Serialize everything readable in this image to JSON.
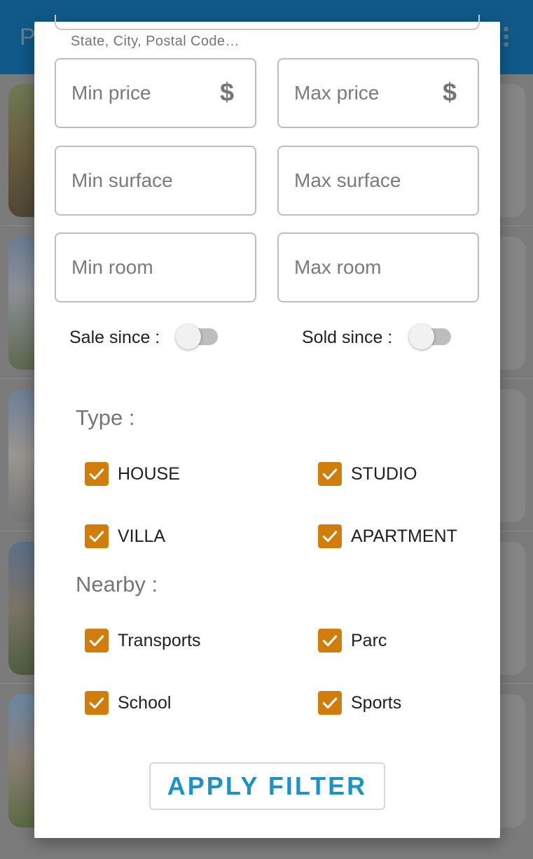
{
  "app_bar": {
    "title": "P"
  },
  "filter": {
    "address_helper": "State, City, Postal Code…",
    "price": {
      "min_placeholder": "Min price",
      "max_placeholder": "Max price",
      "currency_symbol": "$"
    },
    "surface": {
      "min_placeholder": "Min surface",
      "max_placeholder": "Max surface"
    },
    "room": {
      "min_placeholder": "Min room",
      "max_placeholder": "Max room"
    },
    "sale_since": {
      "label": "Sale since :",
      "enabled": false
    },
    "sold_since": {
      "label": "Sold since :",
      "enabled": false
    },
    "type": {
      "label": "Type :",
      "options": [
        {
          "label": "HOUSE",
          "checked": true
        },
        {
          "label": "STUDIO",
          "checked": true
        },
        {
          "label": "VILLA",
          "checked": true
        },
        {
          "label": "APARTMENT",
          "checked": true
        }
      ]
    },
    "nearby": {
      "label": "Nearby :",
      "options": [
        {
          "label": "Transports",
          "checked": true
        },
        {
          "label": "Parc",
          "checked": true
        },
        {
          "label": "School",
          "checked": true
        },
        {
          "label": "Sports",
          "checked": true
        }
      ]
    },
    "apply_label": "APPLY FILTER"
  },
  "colors": {
    "accent_checkbox": "#d07d0c",
    "apply_text": "#1d92c9",
    "app_bar": "#105a8a"
  }
}
